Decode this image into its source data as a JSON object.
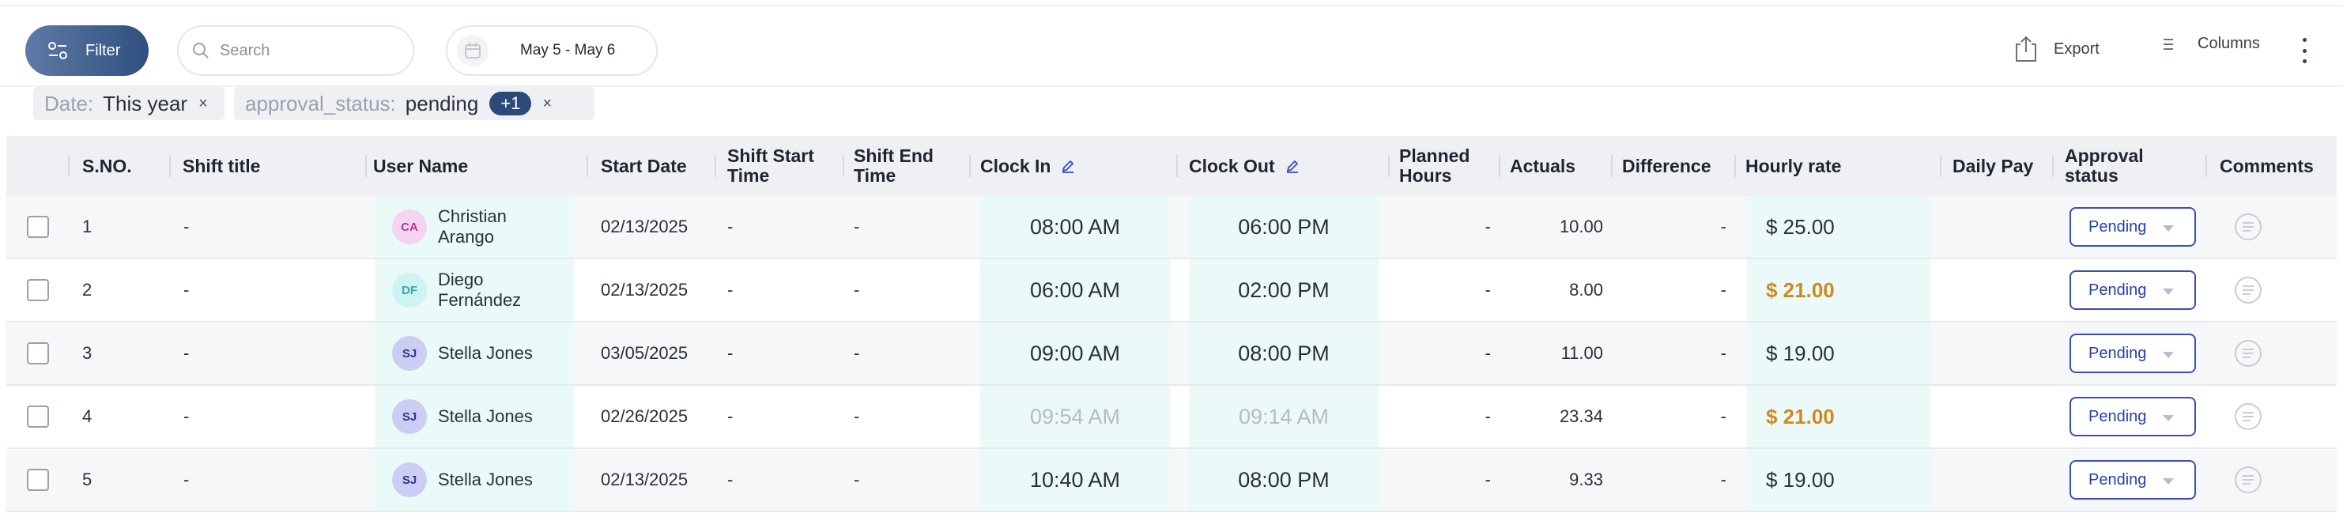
{
  "toolbar": {
    "filter_label": "Filter",
    "search_placeholder": "Search",
    "date_range": "May 5 - May 6",
    "export_label": "Export",
    "columns_label": "Columns"
  },
  "filters": [
    {
      "key": "Date:",
      "value": "This year",
      "remove": "×"
    },
    {
      "key": "approval_status:",
      "value": "pending",
      "more": "+1",
      "remove": "×"
    }
  ],
  "columns": {
    "sno": "S.NO.",
    "shift_title": "Shift title",
    "user_name": "User Name",
    "start_date": "Start Date",
    "shift_start": "Shift Start Time",
    "shift_end": "Shift End Time",
    "clock_in": "Clock In",
    "clock_out": "Clock Out",
    "planned_hours": "Planned Hours",
    "actuals": "Actuals",
    "difference": "Difference",
    "hourly_rate": "Hourly rate",
    "daily_pay": "Daily Pay",
    "approval_status": "Approval status",
    "comments": "Comments"
  },
  "rows": [
    {
      "sno": "1",
      "shift_title": "-",
      "initials": "CA",
      "avatar_bg": "#f6d3f0",
      "avatar_fg": "#b5379c",
      "user": "Christian Arango",
      "start_date": "02/13/2025",
      "shift_start": "-",
      "shift_end": "-",
      "clock_in": "08:00 AM",
      "clock_out": "06:00 PM",
      "planned": "-",
      "actuals": "10.00",
      "difference": "-",
      "rate": "$ 25.00",
      "daily_pay": "",
      "status": "Pending"
    },
    {
      "sno": "2",
      "shift_title": "-",
      "initials": "DF",
      "avatar_bg": "#cdf3f2",
      "avatar_fg": "#3aa9a8",
      "user": "Diego Fernández",
      "start_date": "02/13/2025",
      "shift_start": "-",
      "shift_end": "-",
      "clock_in": "06:00 AM",
      "clock_out": "02:00 PM",
      "planned": "-",
      "actuals": "8.00",
      "difference": "-",
      "rate": "$ 21.00",
      "daily_pay": "",
      "status": "Pending"
    },
    {
      "sno": "3",
      "shift_title": "-",
      "initials": "SJ",
      "avatar_bg": "#cbcdf3",
      "avatar_fg": "#2f3590",
      "user": "Stella Jones",
      "start_date": "03/05/2025",
      "shift_start": "-",
      "shift_end": "-",
      "clock_in": "09:00 AM",
      "clock_out": "08:00 PM",
      "planned": "-",
      "actuals": "11.00",
      "difference": "-",
      "rate": "$ 19.00",
      "daily_pay": "",
      "status": "Pending"
    },
    {
      "sno": "4",
      "shift_title": "-",
      "initials": "SJ",
      "avatar_bg": "#cbcdf3",
      "avatar_fg": "#2f3590",
      "user": "Stella Jones",
      "start_date": "02/26/2025",
      "shift_start": "-",
      "shift_end": "-",
      "clock_in": "09:54 AM",
      "clock_out": "09:14 AM",
      "planned": "-",
      "actuals": "23.34",
      "difference": "-",
      "rate": "$ 21.00",
      "daily_pay": "",
      "status": "Pending"
    },
    {
      "sno": "5",
      "shift_title": "-",
      "initials": "SJ",
      "avatar_bg": "#cbcdf3",
      "avatar_fg": "#2f3590",
      "user": "Stella Jones",
      "start_date": "02/13/2025",
      "shift_start": "-",
      "shift_end": "-",
      "clock_in": "10:40 AM",
      "clock_out": "08:00 PM",
      "planned": "-",
      "actuals": "9.33",
      "difference": "-",
      "rate": "$ 19.00",
      "daily_pay": "",
      "status": "Pending"
    }
  ],
  "colors": {
    "accent": "#2c4a78",
    "rate_highlight": "#d1891f",
    "select_border": "#3a4bc4",
    "time_band": "#ebfaf8"
  }
}
